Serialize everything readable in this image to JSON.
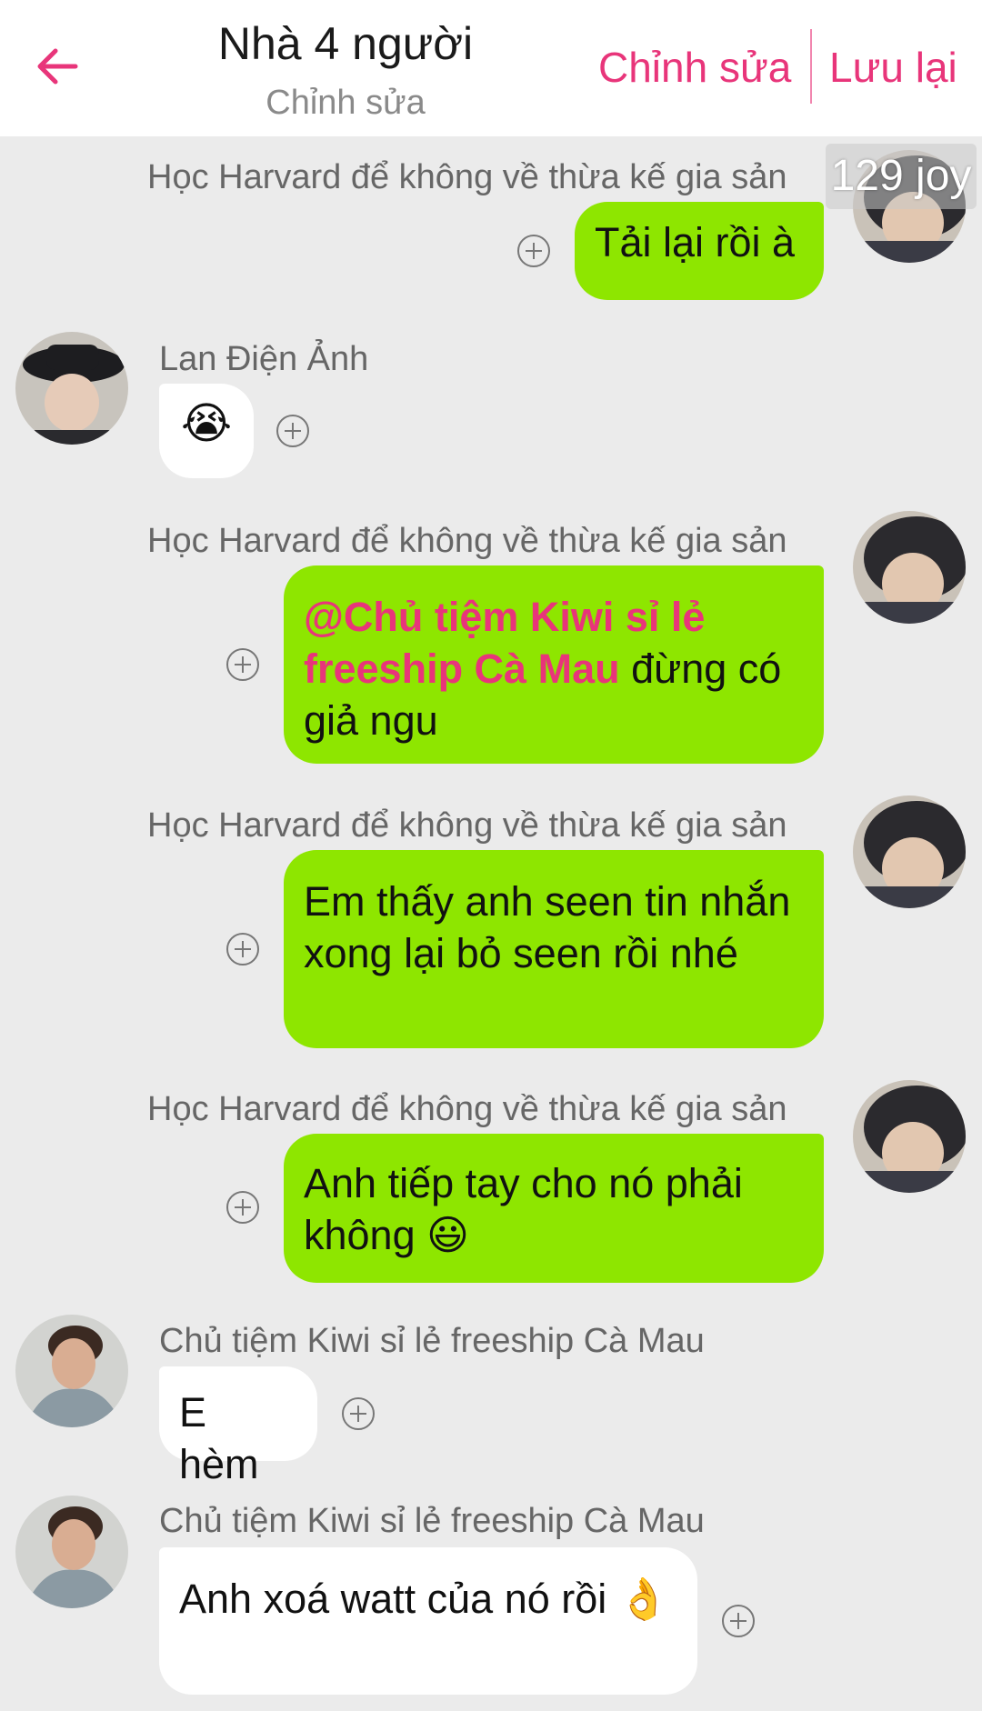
{
  "header": {
    "title": "Nhà 4 người",
    "subtitle": "Chỉnh sửa",
    "edit_label": "Chỉnh sửa",
    "save_label": "Lưu lại",
    "accent_color": "#e8357a"
  },
  "watermark": "129 joy",
  "messages": [
    {
      "sender": "Học Harvard để không về thừa kế gia sản",
      "text": "Tải lại rồi à",
      "side": "right"
    },
    {
      "sender": "Lan Điện Ảnh",
      "text": "😭",
      "side": "left"
    },
    {
      "sender": "Học Harvard để không về thừa kế gia sản",
      "mention": "@Chủ tiệm Kiwi sỉ lẻ freeship Cà Mau",
      "text": " đừng có giả ngu",
      "side": "right"
    },
    {
      "sender": "Học Harvard để không về thừa kế gia sản",
      "text": "Em thấy anh seen tin nhắn xong lại bỏ seen rồi nhé",
      "side": "right"
    },
    {
      "sender": "Học Harvard để không về thừa kế gia sản",
      "text": "Anh tiếp tay cho nó phải không 😃",
      "side": "right"
    },
    {
      "sender": "Chủ tiệm Kiwi sỉ lẻ freeship Cà Mau",
      "text": "E hèm",
      "side": "left"
    },
    {
      "sender": "Chủ tiệm Kiwi sỉ lẻ freeship Cà Mau",
      "text": "Anh xoá watt của nó rồi 👌",
      "side": "left"
    }
  ],
  "colors": {
    "my_bubble": "#8ee600",
    "their_bubble": "#ffffff",
    "background": "#ebebeb"
  }
}
